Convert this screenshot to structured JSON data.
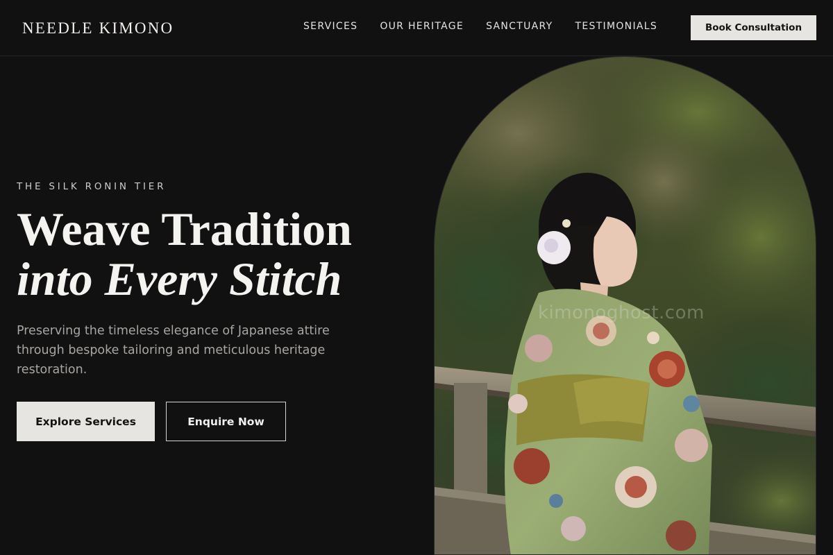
{
  "brand": {
    "name": "NEEDLE KIMONO"
  },
  "nav": {
    "items": [
      {
        "label": "SERVICES"
      },
      {
        "label": "OUR HERITAGE"
      },
      {
        "label": "SANCTUARY"
      },
      {
        "label": "TESTIMONIALS"
      }
    ],
    "cta_label": "Book Consultation"
  },
  "hero": {
    "eyebrow": "THE SILK RONIN TIER",
    "headline_line1": "Weave Tradition",
    "headline_line2": "into Every Stitch",
    "subtext": "Preserving the timeless elegance of Japanese attire through bespoke tailoring and meticulous heritage restoration.",
    "primary_button": "Explore Services",
    "secondary_button": "Enquire Now"
  },
  "image": {
    "description_icon": "kimono-woman-photo",
    "watermark": "kimonoghost.com"
  },
  "colors": {
    "background": "#121112",
    "button_light": "#e7e5e2",
    "text_muted": "#a9a6a2"
  }
}
